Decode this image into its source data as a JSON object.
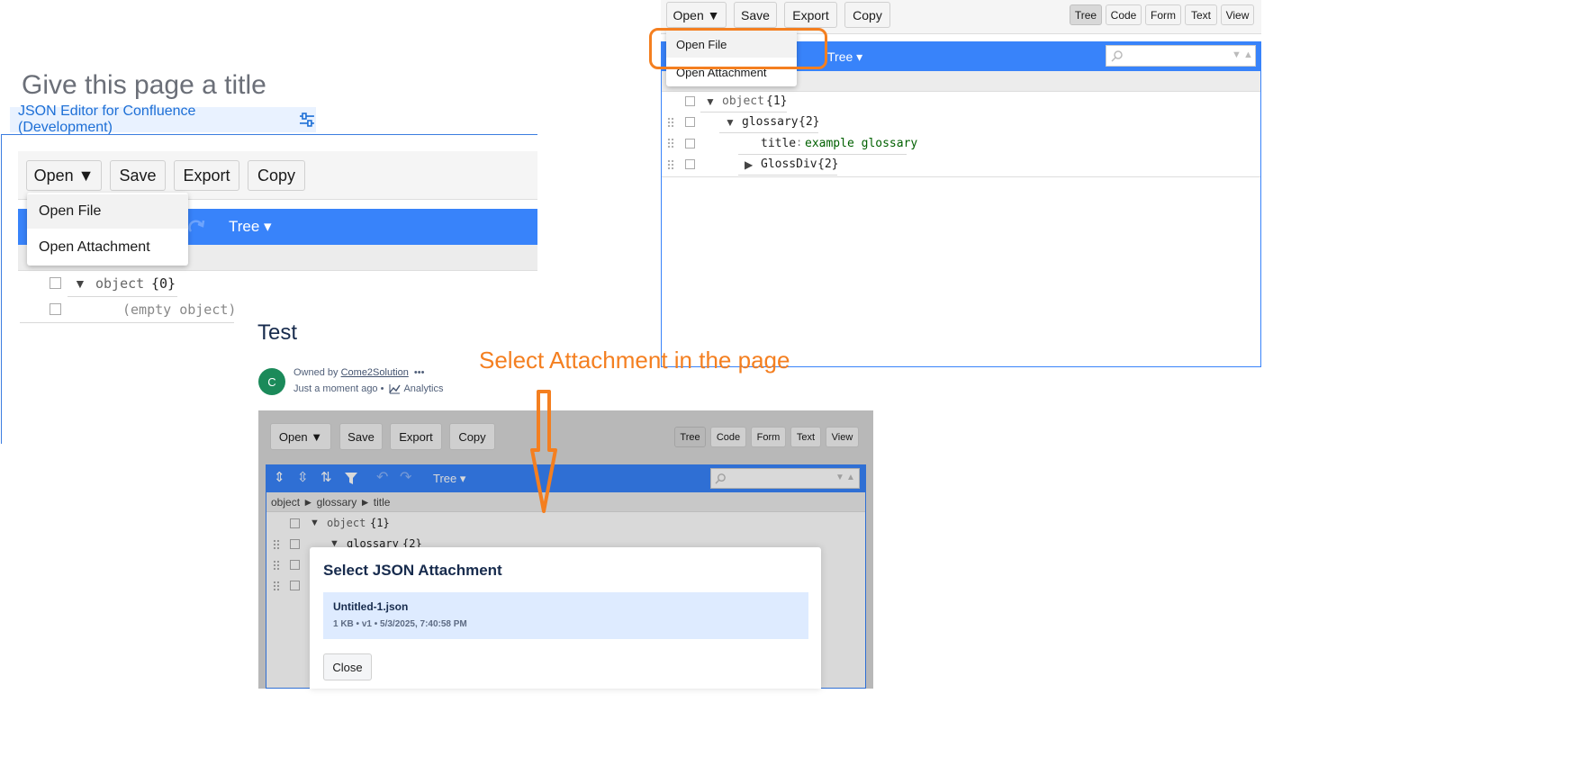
{
  "page": {
    "title_placeholder": "Give this page a title",
    "macro_label": "JSON Editor for Confluence (Development)",
    "section_title": "Test",
    "owner_prefix": "Owned by",
    "owner_name": "Come2Solution",
    "more": "•••",
    "time": "Just a moment ago •",
    "analytics": "Analytics",
    "avatar_letter": "C",
    "avatar_color": "#1b8a5a"
  },
  "annotation": {
    "text": "Select Attachment in the page",
    "color": "#f47f20"
  },
  "toolbar": {
    "open": "Open ▼",
    "save": "Save",
    "export": "Export",
    "copy": "Copy",
    "modes": [
      "Tree",
      "Code",
      "Form",
      "Text",
      "View"
    ]
  },
  "open_menu": {
    "items": [
      "Open File",
      "Open Attachment"
    ]
  },
  "editor_left": {
    "mode_label": "Tree ▾",
    "nodes": [
      {
        "key": "object",
        "value": "{0}"
      },
      {
        "text": "(empty object)"
      }
    ]
  },
  "editor_right": {
    "mode_label": "Tree ▾",
    "nodes": [
      {
        "key": "object",
        "value": "{1}"
      },
      {
        "key": "glossary",
        "value": "{2}"
      },
      {
        "key": "title",
        "sep": ":",
        "value": "example glossary"
      },
      {
        "key": "GlossDiv",
        "value": "{2}"
      }
    ]
  },
  "editor_bottom": {
    "mode_label": "Tree ▾",
    "breadcrumb": "object ► glossary ► title",
    "nodes": [
      {
        "key": "object",
        "value": "{1}"
      },
      {
        "key": "glossary",
        "value": "{2}"
      }
    ]
  },
  "dialog": {
    "title": "Select JSON Attachment",
    "file_name": "Untitled-1.json",
    "file_meta": "1 KB • v1 • 5/3/2025, 7:40:58 PM",
    "close": "Close"
  },
  "colors": {
    "accent": "#3883fa",
    "highlight": "#f47f20",
    "value_string": "#006000",
    "key_gray": "#555555"
  }
}
